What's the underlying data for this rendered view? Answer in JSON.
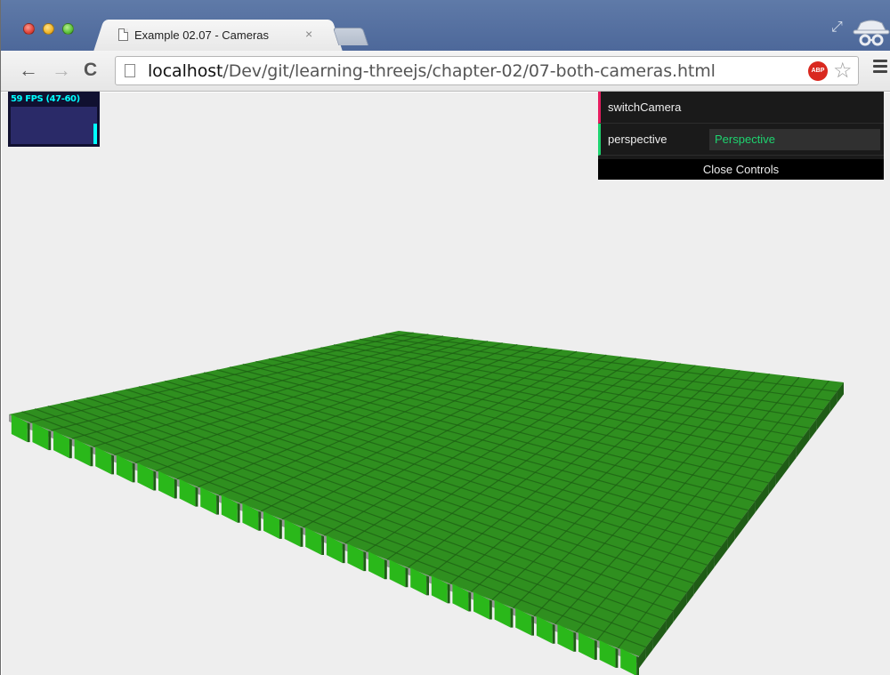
{
  "browser": {
    "tab_title": "Example 02.07 - Cameras",
    "tab_close": "×",
    "url_host": "localhost",
    "url_path": "/Dev/git/learning-threejs/chapter-02/07-both-cameras.html",
    "abp_label": "ABP",
    "nav": {
      "back": "←",
      "forward": "→",
      "reload": "C"
    }
  },
  "stats": {
    "text": "59 FPS (47-60)",
    "bar_fraction": 0.55
  },
  "gui": {
    "controls": [
      {
        "label": "switchCamera",
        "type": "function"
      },
      {
        "label": "perspective",
        "type": "string",
        "value": "Perspective"
      }
    ],
    "close_label": "Close Controls",
    "accent_function": "#e61d5f",
    "accent_string": "#1ed36f"
  },
  "scene": {
    "description_colors": {
      "background": "#eeeeee",
      "cube_top": "#2f8f1f",
      "cube_front": "#2ab81a",
      "cube_side": "#1f5c16",
      "plane": "#999999"
    },
    "grid": {
      "rows": 30,
      "cols": 30
    }
  }
}
